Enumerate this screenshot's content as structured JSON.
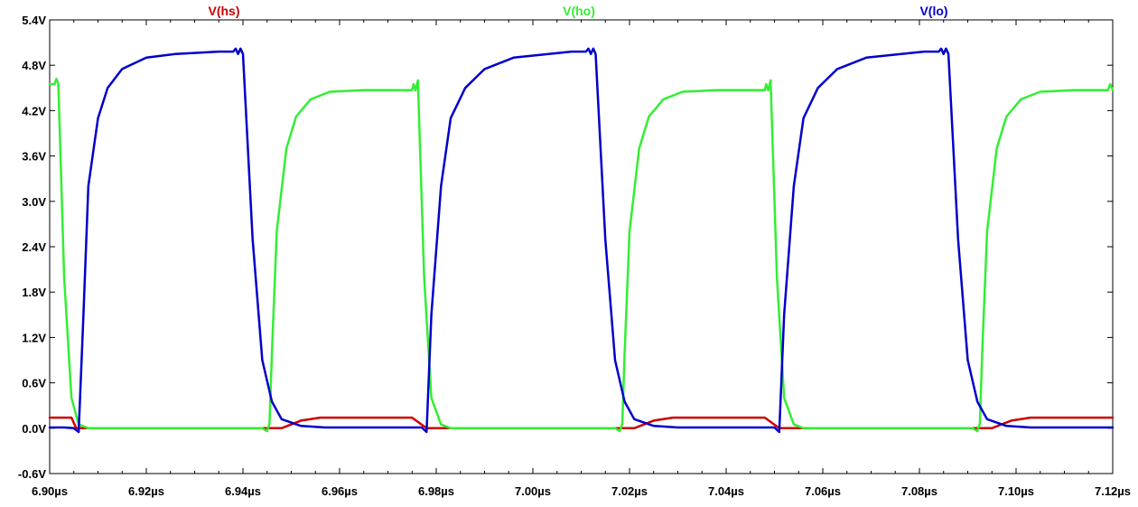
{
  "chart_data": {
    "type": "line",
    "title": "",
    "xlabel": "",
    "ylabel": "",
    "x_unit": "µs",
    "xlim": [
      6.9,
      7.12
    ],
    "ylim": [
      -0.6,
      5.4
    ],
    "grid": false,
    "legend_placement": "top",
    "x_ticks": [
      "6.90µs",
      "6.92µs",
      "6.94µs",
      "6.96µs",
      "6.98µs",
      "7.00µs",
      "7.02µs",
      "7.04µs",
      "7.06µs",
      "7.08µs",
      "7.10µs",
      "7.12µs"
    ],
    "y_ticks": [
      "5.4V",
      "4.8V",
      "4.2V",
      "3.6V",
      "3.0V",
      "2.4V",
      "1.8V",
      "1.2V",
      "0.6V",
      "0.0V",
      "-0.6V"
    ],
    "series": [
      {
        "name": "V(hs)",
        "color": "#cc0000",
        "x": [
          6.9,
          6.9025,
          6.9045,
          6.9055,
          6.944,
          6.948,
          6.952,
          6.956,
          6.975,
          6.978,
          6.98,
          7.017,
          7.021,
          7.025,
          7.029,
          7.048,
          7.051,
          7.053,
          7.091,
          7.095,
          7.099,
          7.103,
          7.12
        ],
        "y": [
          0.14,
          0.14,
          0.14,
          0.0,
          0.0,
          0.0,
          0.1,
          0.14,
          0.14,
          0.0,
          0.0,
          0.0,
          0.0,
          0.1,
          0.14,
          0.14,
          0.0,
          0.0,
          0.0,
          0.0,
          0.1,
          0.14,
          0.14
        ]
      },
      {
        "name": "V(ho)",
        "color": "#33ee33",
        "x": [
          6.9,
          6.901,
          6.9014,
          6.9018,
          6.903,
          6.9045,
          6.906,
          6.908,
          6.91,
          6.912,
          6.944,
          6.945,
          6.9455,
          6.946,
          6.947,
          6.949,
          6.951,
          6.954,
          6.958,
          6.965,
          6.975,
          6.9753,
          6.9757,
          6.9762,
          6.9775,
          6.979,
          6.981,
          6.983,
          6.985,
          7.017,
          7.018,
          7.0185,
          7.019,
          7.02,
          7.022,
          7.024,
          7.027,
          7.031,
          7.038,
          7.048,
          7.0483,
          7.0487,
          7.0492,
          7.0505,
          7.052,
          7.054,
          7.056,
          7.058,
          7.091,
          7.092,
          7.0925,
          7.093,
          7.094,
          7.096,
          7.098,
          7.101,
          7.105,
          7.112,
          7.119,
          7.1195,
          7.12
        ],
        "y": [
          4.55,
          4.55,
          4.62,
          4.55,
          2.0,
          0.4,
          0.05,
          0.0,
          0.0,
          0.0,
          0.0,
          -0.04,
          0.06,
          1.0,
          2.6,
          3.7,
          4.12,
          4.35,
          4.45,
          4.47,
          4.47,
          4.55,
          4.47,
          4.6,
          2.0,
          0.4,
          0.05,
          0.0,
          0.0,
          0.0,
          -0.04,
          0.06,
          1.0,
          2.6,
          3.7,
          4.12,
          4.35,
          4.45,
          4.47,
          4.47,
          4.55,
          4.47,
          4.6,
          2.0,
          0.4,
          0.05,
          0.0,
          0.0,
          0.0,
          -0.04,
          0.06,
          1.0,
          2.6,
          3.7,
          4.12,
          4.35,
          4.45,
          4.47,
          4.47,
          4.55,
          4.47
        ]
      },
      {
        "name": "V(lo)",
        "color": "#0000cc",
        "x": [
          6.9,
          6.903,
          6.905,
          6.906,
          6.907,
          6.908,
          6.91,
          6.912,
          6.915,
          6.92,
          6.926,
          6.935,
          6.938,
          6.9385,
          6.939,
          6.9395,
          6.94,
          6.942,
          6.944,
          6.946,
          6.948,
          6.952,
          6.957,
          6.965,
          6.977,
          6.978,
          6.979,
          6.981,
          6.983,
          6.986,
          6.99,
          6.996,
          7.008,
          7.011,
          7.0115,
          7.012,
          7.0125,
          7.013,
          7.015,
          7.017,
          7.019,
          7.021,
          7.025,
          7.03,
          7.038,
          7.05,
          7.051,
          7.052,
          7.054,
          7.056,
          7.059,
          7.063,
          7.069,
          7.081,
          7.084,
          7.0845,
          7.085,
          7.0855,
          7.086,
          7.088,
          7.09,
          7.092,
          7.094,
          7.098,
          7.103,
          7.112,
          7.12
        ],
        "y": [
          0.01,
          0.01,
          0.0,
          -0.05,
          1.5,
          3.2,
          4.1,
          4.5,
          4.75,
          4.9,
          4.95,
          4.98,
          4.98,
          5.02,
          4.95,
          5.02,
          4.95,
          2.5,
          0.9,
          0.35,
          0.12,
          0.03,
          0.01,
          0.01,
          0.01,
          -0.05,
          1.5,
          3.2,
          4.1,
          4.5,
          4.75,
          4.9,
          4.98,
          4.98,
          5.02,
          4.95,
          5.02,
          4.95,
          2.5,
          0.9,
          0.35,
          0.12,
          0.03,
          0.01,
          0.01,
          0.01,
          -0.05,
          1.5,
          3.2,
          4.1,
          4.5,
          4.75,
          4.9,
          4.98,
          4.98,
          5.02,
          4.95,
          5.02,
          4.95,
          2.5,
          0.9,
          0.35,
          0.12,
          0.03,
          0.01,
          0.01,
          0.01
        ]
      }
    ]
  }
}
